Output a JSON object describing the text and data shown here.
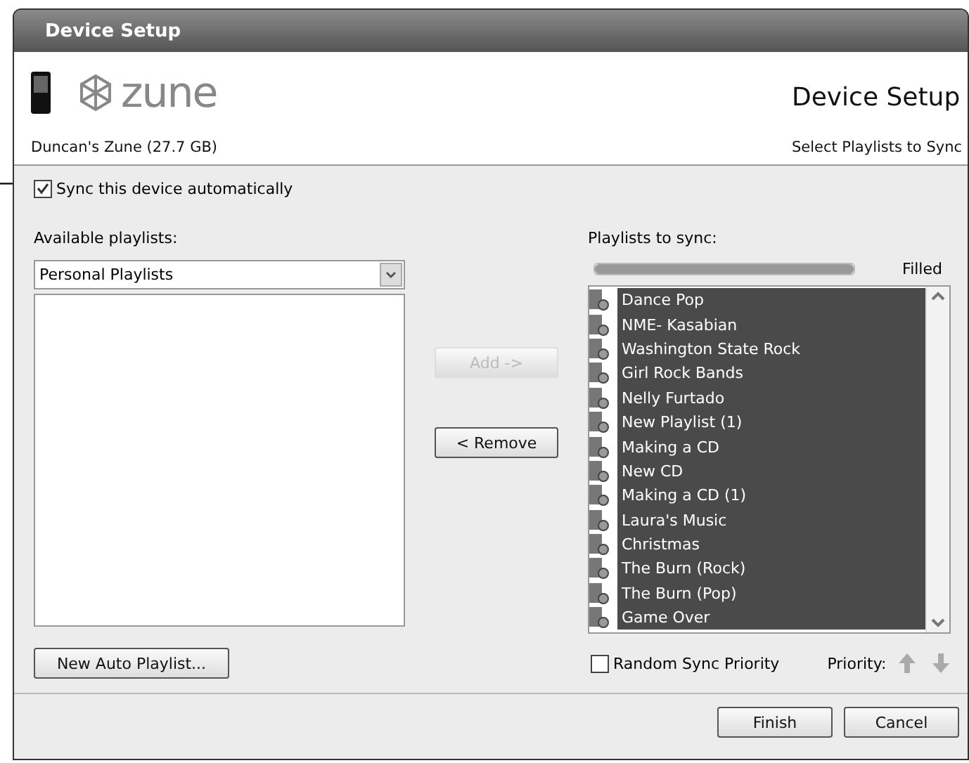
{
  "window": {
    "title": "Device Setup"
  },
  "header": {
    "logo": "zune",
    "device_name": "Duncan's Zune (27.7 GB)",
    "title": "Device Setup",
    "subtitle": "Select Playlists to Sync"
  },
  "sync_auto": {
    "label": "Sync this device automatically",
    "checked": true
  },
  "available": {
    "label": "Available playlists:",
    "category": "Personal Playlists"
  },
  "buttons": {
    "add": {
      "label": "Add  ->",
      "disabled": true
    },
    "remove": {
      "label": "<  Remove",
      "disabled": false
    },
    "new_auto": "New Auto Playlist...",
    "finish": "Finish",
    "cancel": "Cancel"
  },
  "to_sync": {
    "label": "Playlists to sync:",
    "capacity": {
      "level": 1,
      "reading": "Filled"
    },
    "items": [
      {
        "name": "Dance Pop",
        "selected": true
      },
      {
        "name": "NME- Kasabian",
        "selected": true
      },
      {
        "name": "Washington State Rock",
        "selected": true
      },
      {
        "name": "Girl Rock Bands",
        "selected": true
      },
      {
        "name": "Nelly Furtado",
        "selected": true
      },
      {
        "name": "New Playlist (1)",
        "selected": true
      },
      {
        "name": "Making a CD",
        "selected": true
      },
      {
        "name": "New CD",
        "selected": true
      },
      {
        "name": "Making a CD (1)",
        "selected": true
      },
      {
        "name": "Laura's Music",
        "selected": true
      },
      {
        "name": "Christmas",
        "selected": true
      },
      {
        "name": "The Burn (Rock)",
        "selected": true
      },
      {
        "name": "The Burn (Pop)",
        "selected": true
      },
      {
        "name": "Game Over",
        "selected": true
      }
    ]
  },
  "random_priority": {
    "label": "Random Sync Priority",
    "checked": false
  },
  "priority_label": "Priority:"
}
